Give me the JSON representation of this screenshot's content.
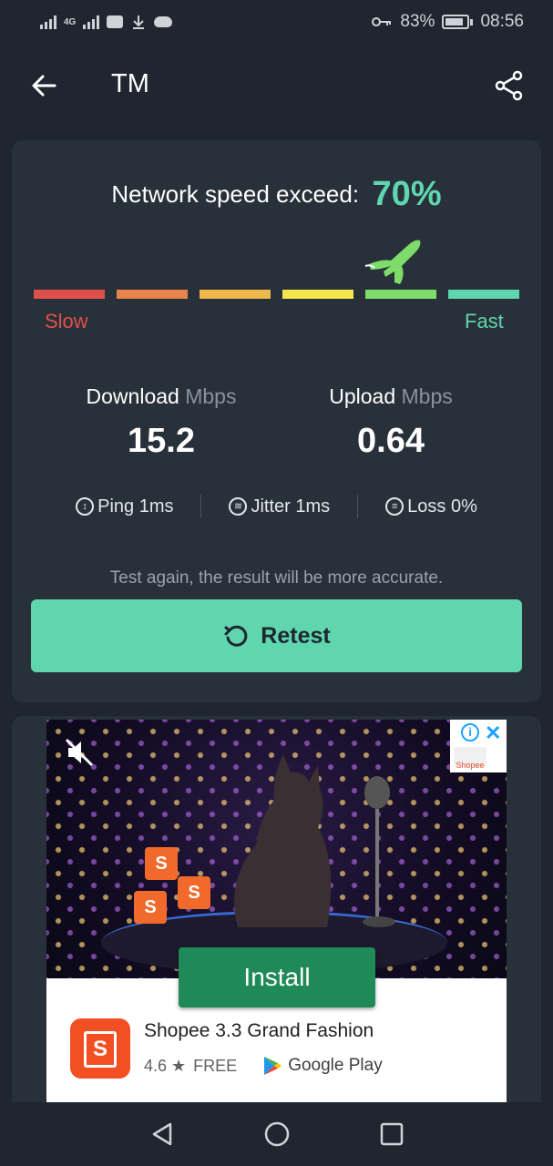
{
  "status_bar": {
    "network": "4G",
    "battery": "83%",
    "time": "08:56",
    "battery_level": 0.83
  },
  "app_bar": {
    "title": "TM",
    "back_icon": "arrow-left-icon",
    "share_icon": "share-icon"
  },
  "result": {
    "exceed_label": "Network speed exceed:",
    "exceed_value": "70%",
    "meter_colors": [
      "#e0504a",
      "#e8834a",
      "#efb84a",
      "#f3e54a",
      "#7ddc6a",
      "#5fd6ae"
    ],
    "meter_active_segment": 5,
    "slow_label": "Slow",
    "fast_label": "Fast",
    "download": {
      "label": "Download",
      "unit": "Mbps",
      "value": "15.2"
    },
    "upload": {
      "label": "Upload",
      "unit": "Mbps",
      "value": "0.64"
    },
    "ping": "Ping 1ms",
    "jitter": "Jitter 1ms",
    "loss": "Loss 0%",
    "hint": "Test again, the result will be more accurate.",
    "retest_label": "Retest"
  },
  "ad": {
    "install_label": "Install",
    "app_name": "Shopee 3.3 Grand Fashion",
    "rating": "4.6 ★",
    "price": "FREE",
    "store": "Google Play",
    "sponsor_badge": "Shopee",
    "bag_letter": "S"
  },
  "colors": {
    "background": "#1f2630",
    "card": "#28303a",
    "accent": "#5fd6ae",
    "slow": "#e0504a",
    "install": "#1f8a57"
  }
}
